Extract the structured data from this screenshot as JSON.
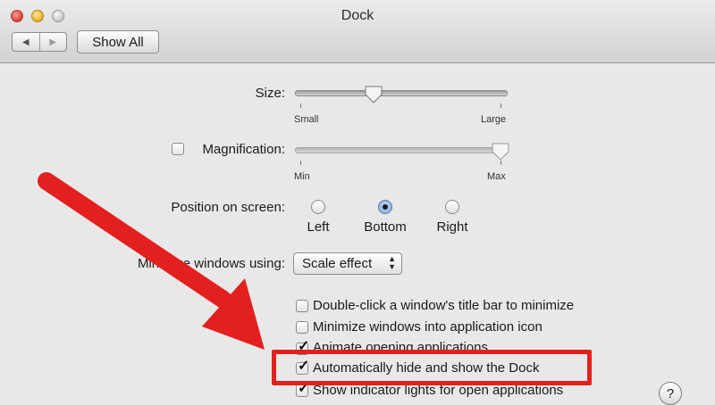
{
  "window": {
    "title": "Dock"
  },
  "toolbar": {
    "back_glyph": "◀",
    "forward_glyph": "▶",
    "show_all_label": "Show All"
  },
  "size": {
    "label": "Size:",
    "min_label": "Small",
    "max_label": "Large",
    "value_fraction": 0.36
  },
  "magnification": {
    "label": "Magnification:",
    "checked": false,
    "min_label": "Min",
    "max_label": "Max",
    "value_fraction": 1.0
  },
  "position": {
    "label": "Position on screen:",
    "options": [
      {
        "label": "Left",
        "selected": false
      },
      {
        "label": "Bottom",
        "selected": true
      },
      {
        "label": "Right",
        "selected": false
      }
    ]
  },
  "minimize": {
    "label": "Minimize windows using:",
    "selected": "Scale effect"
  },
  "options": [
    {
      "label": "Double-click a window's title bar to minimize",
      "checked": false
    },
    {
      "label": "Minimize windows into application icon",
      "checked": false
    },
    {
      "label": "Animate opening applications",
      "checked": true
    },
    {
      "label": "Automatically hide and show the Dock",
      "checked": true
    },
    {
      "label": "Show indicator lights for open applications",
      "checked": true
    }
  ],
  "help": {
    "glyph": "?"
  },
  "annotation": {
    "color": "#e3201f"
  },
  "colors": {
    "accent": "#e3201f",
    "selected_radio": "#8fb4e3"
  }
}
